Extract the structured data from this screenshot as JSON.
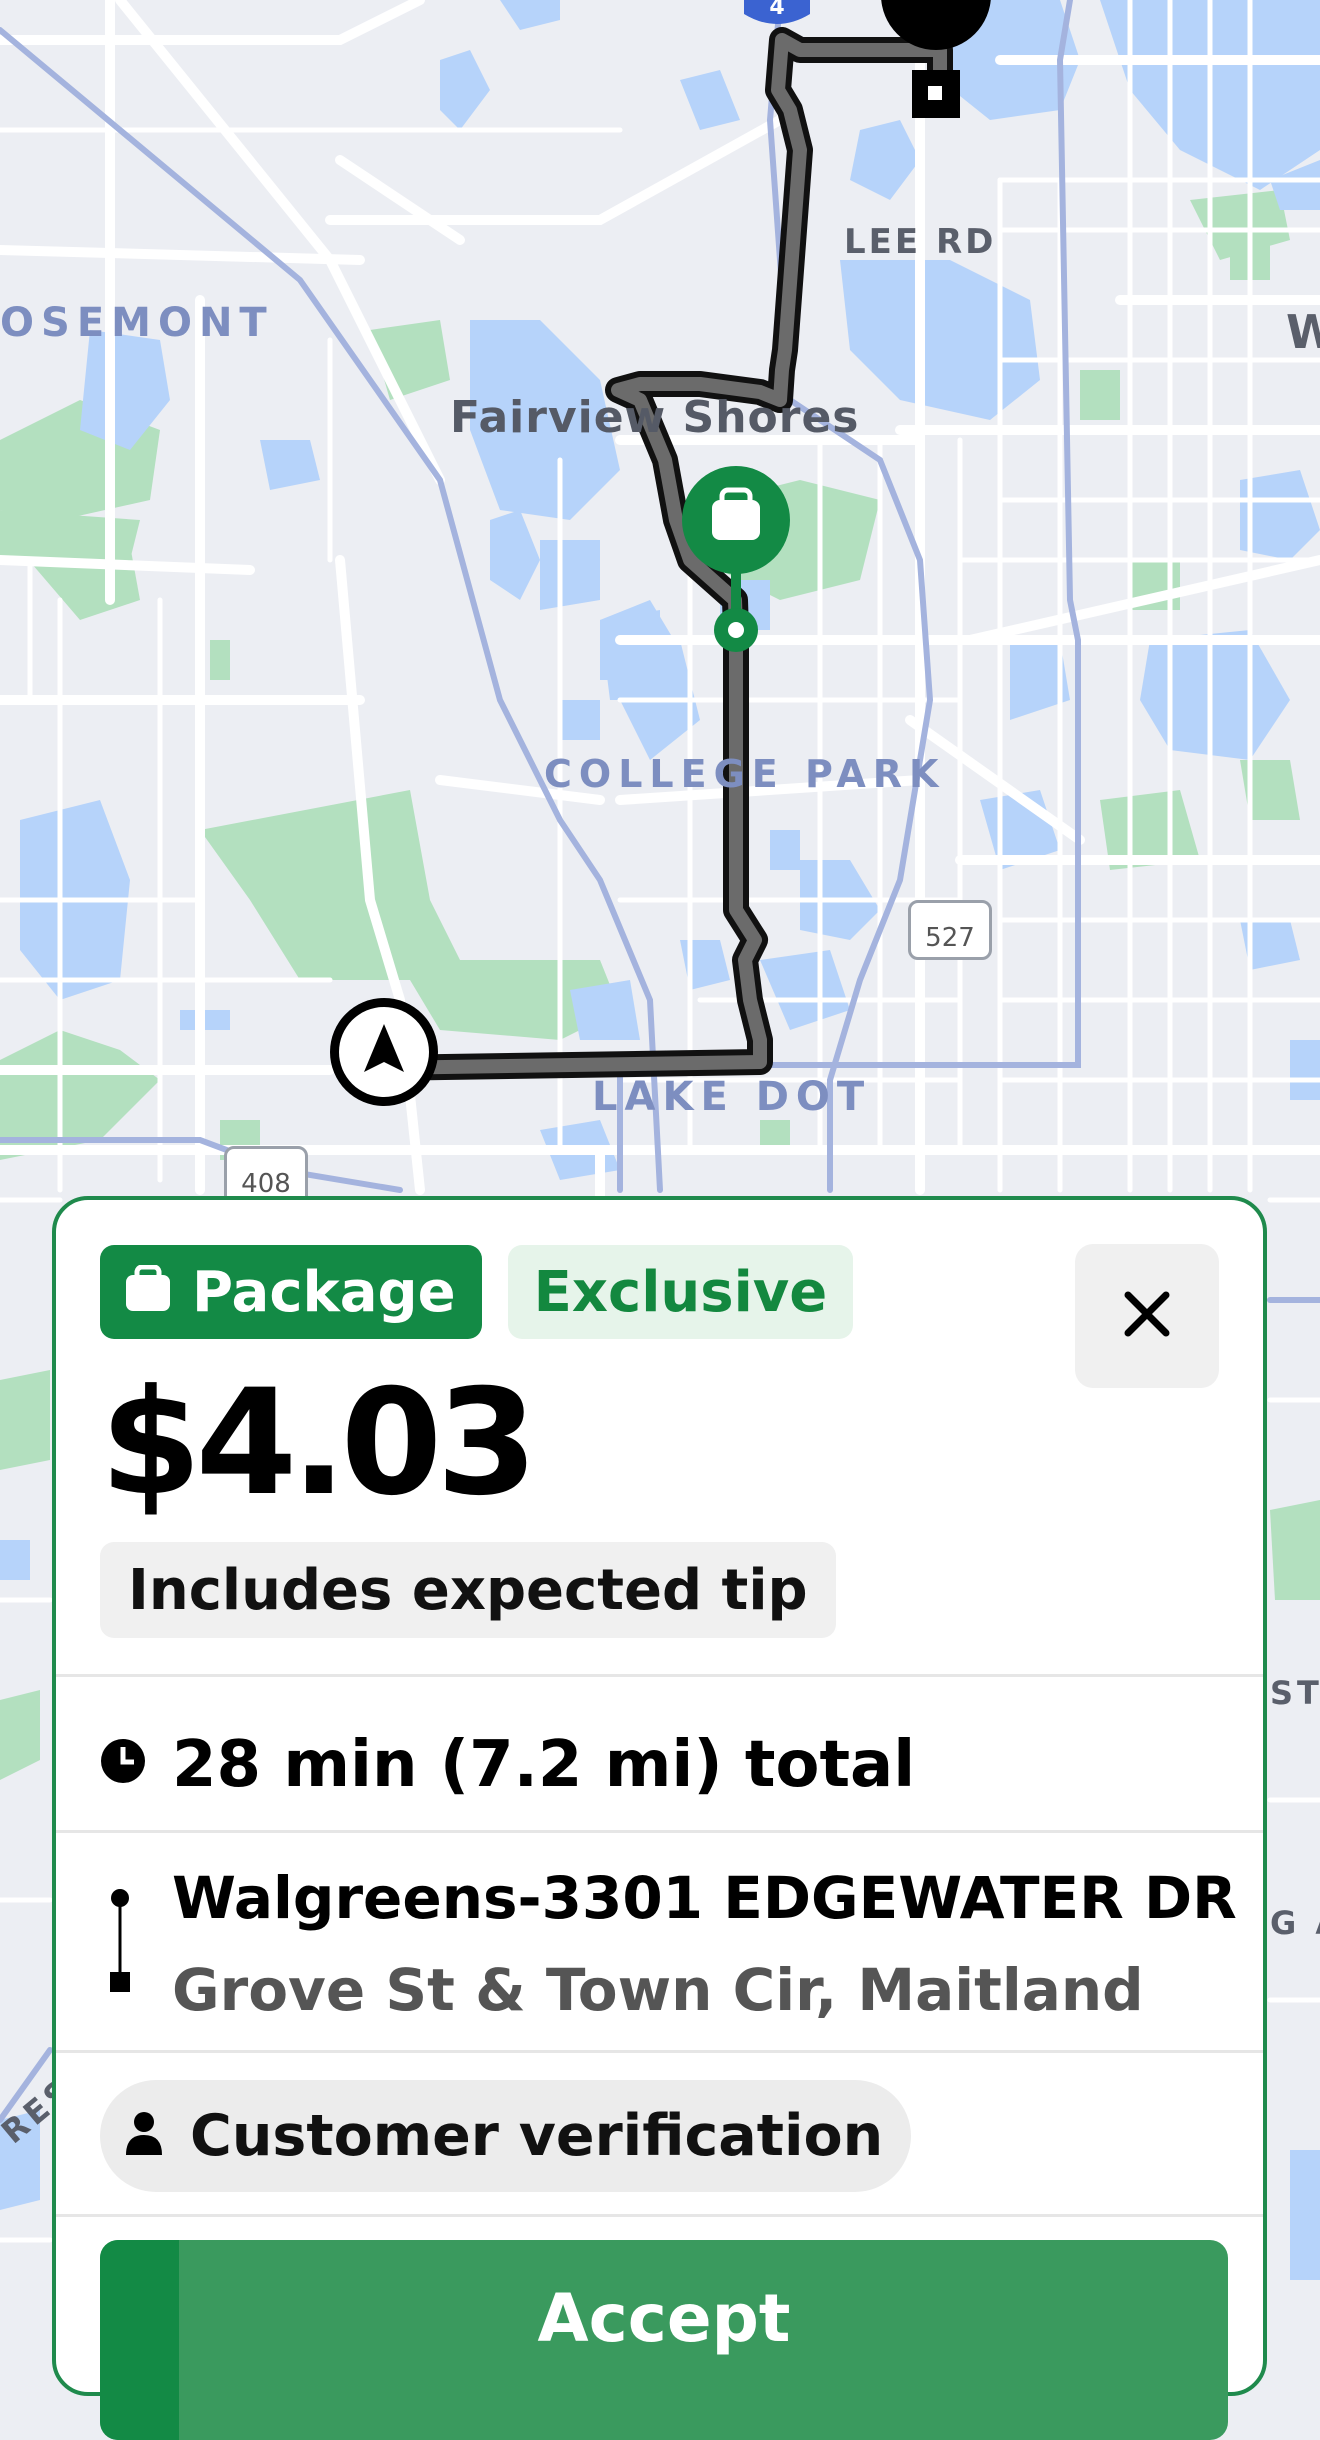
{
  "map": {
    "labels": {
      "lee_rd": "LEE RD",
      "rosemont": "OSEMONT",
      "fairview_shores": "Fairview Shores",
      "college_park": "COLLEGE PARK",
      "lake_dot": "LAKE DOT",
      "edge_w": "W",
      "edge_st": "ST",
      "edge_ga": "G A",
      "edge_res": "RES"
    },
    "shields": {
      "sr527": "527",
      "sr408": "408"
    },
    "interstate": "4",
    "colors": {
      "route": "#6b6b6b",
      "route_outline": "#111111",
      "pickup": "#138a45",
      "water": "#b6d3fa",
      "park": "#b3e0bf",
      "road": "#ffffff",
      "major_road": "#a4b3de"
    },
    "icons": {
      "pickup": "bag-icon",
      "dropoff": "dropoff-square-icon",
      "current_location": "navigation-arrow-icon"
    }
  },
  "offer": {
    "type_badge": "Package",
    "exclusive_badge": "Exclusive",
    "price": "$4.03",
    "tip_note": "Includes expected tip",
    "duration_text": "28 min (7.2 mi) total",
    "pickup": "Walgreens-3301 EDGEWATER DR",
    "dropoff": "Grove St & Town Cir, Maitland",
    "verification": "Customer verification",
    "accept_label": "Accept",
    "accept_progress": 0.07,
    "colors": {
      "brand_green": "#138a45",
      "exclusive_bg": "#e6f4ea",
      "accept_bg": "#3a9a5e"
    },
    "icons": {
      "badge": "bag-icon",
      "close": "close-icon",
      "duration": "clock-icon",
      "route": "route-line-icon",
      "verification": "person-icon"
    }
  }
}
